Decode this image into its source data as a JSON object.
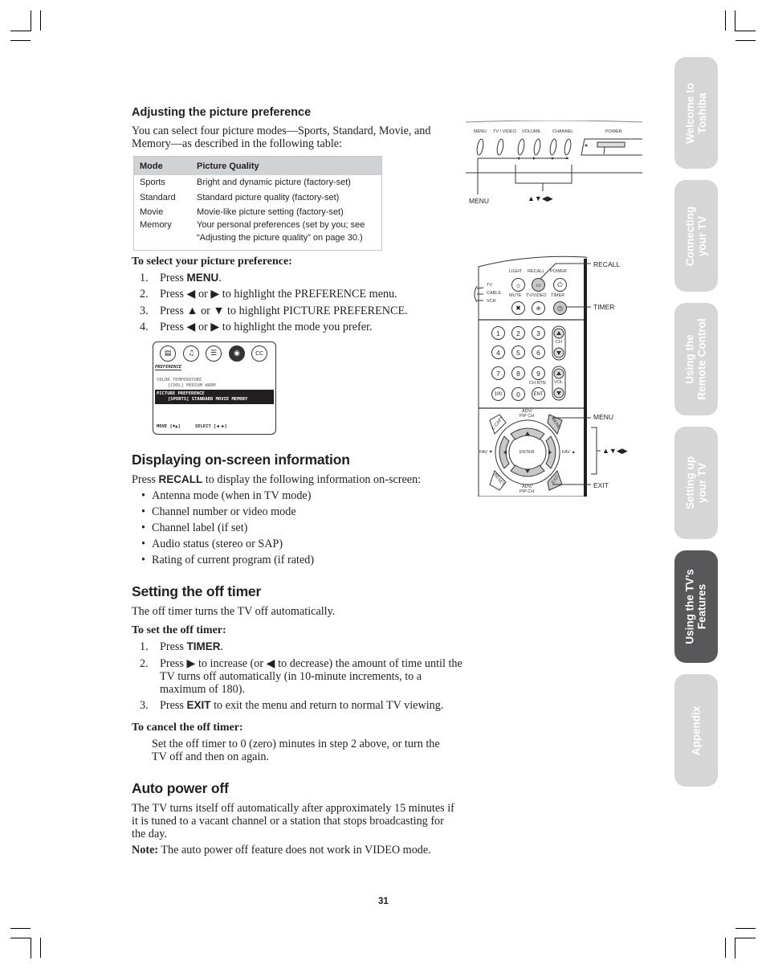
{
  "section1": {
    "heading": "Adjusting the picture preference",
    "intro_line1": "You can select four picture modes—Sports, Standard, Movie, and",
    "intro_line2": "Memory—as described in the following table:",
    "table": {
      "headers": [
        "Mode",
        "Picture Quality"
      ],
      "rows": [
        {
          "mode": "Sports",
          "quality": "Bright and dynamic picture (factory-set)"
        },
        {
          "mode": "Standard",
          "quality": "Standard picture quality (factory-set)"
        },
        {
          "mode": "Movie",
          "quality": "Movie-like picture setting  (factory-set)"
        },
        {
          "mode": "Memory",
          "quality": "Your personal preferences (set by you; see",
          "quality2": "“Adjusting the picture quality” on page 30.)"
        }
      ]
    },
    "procedure_title": "To select your picture preference:",
    "steps": [
      {
        "num": "1.",
        "pre": "Press ",
        "kw": "MENU",
        "post": "."
      },
      {
        "num": "2.",
        "pre": "Press ◀ or ▶ to highlight the PREFERENCE menu."
      },
      {
        "num": "3.",
        "pre": "Press ▲ or ▼ to highlight PICTURE PREFERENCE."
      },
      {
        "num": "4.",
        "pre": "Press ◀ or ▶ to highlight the mode you prefer."
      }
    ],
    "osd": {
      "icons": [
        "picture-icon",
        "audio-icon",
        "setup-icon",
        "preference-icon",
        "cc-icon"
      ],
      "cc_label": "CC",
      "menu_title": "PREFERENCE",
      "color_temp_label": "COLOR TEMPERATURE",
      "color_temp_options": "[COOL] MEDIUM WARM",
      "picture_pref_label": "PICTURE PREFERENCE",
      "picture_pref_options": "[SPORTS] STANDARD  MOVIE  MEMORY",
      "move_hint": "MOVE [▼▲]",
      "select_hint": "SELECT [◀ ▶]"
    }
  },
  "section2": {
    "heading": "Displaying on-screen information",
    "intro_pre": "Press ",
    "intro_kw": "RECALL",
    "intro_post": " to display the following information on-screen:",
    "bullets": [
      "Antenna mode (when in TV mode)",
      "Channel number or video mode",
      "Channel label (if set)",
      "Audio status (stereo or SAP)",
      "Rating of current program (if rated)"
    ]
  },
  "section3": {
    "heading": "Setting the off timer",
    "intro": "The off timer turns the TV off automatically.",
    "procedure_title": "To set the off timer:",
    "step1": {
      "num": "1.",
      "pre": "Press ",
      "kw": "TIMER",
      "post": "."
    },
    "step2": {
      "num": "2.",
      "line1": "Press ▶ to increase (or ◀ to decrease) the amount of time until the",
      "line2": "TV turns off automatically (in 10-minute increments, to a",
      "line3": "maximum of 180)."
    },
    "step3": {
      "num": "3.",
      "pre": "Press ",
      "kw": "EXIT",
      "post": " to exit the menu and return to normal TV viewing."
    },
    "cancel_title": "To cancel the off timer:",
    "cancel_line1": "Set the off timer to 0 (zero) minutes in step 2 above, or turn the",
    "cancel_line2": "TV off and then on again."
  },
  "section4": {
    "heading": "Auto power off",
    "line1": "The TV turns itself off automatically after approximately 15 minutes if",
    "line2": "it is tuned to a vacant channel or a station that stops broadcasting for",
    "line3": "the day.",
    "note_label": "Note:",
    "note_text": " The auto power off feature does not work in VIDEO mode."
  },
  "tv_panel": {
    "labels": [
      "MENU",
      "TV / VIDEO",
      "VOLUME",
      "CHANNEL",
      "POWER"
    ],
    "callout_menu": "MENU",
    "callout_arrows": "▲▼◀▶"
  },
  "remote": {
    "top_labels": {
      "light": "LIGHT",
      "recall": "RECALL",
      "power": "POWER",
      "mute": "MUTE",
      "tvvideo": "TV/VIDEO",
      "timer": "TIMER"
    },
    "modes": [
      "TV",
      "CABLE",
      "VCR"
    ],
    "keys": [
      "1",
      "2",
      "3",
      "4",
      "5",
      "6",
      "7",
      "8",
      "9",
      "100",
      "0",
      "ENT"
    ],
    "ch_label": "CH",
    "vol_label": "VOL",
    "chrtn_label": "CH RTN",
    "adv_top": "ADV/\nPIP CH",
    "adv_label1": "ADV/",
    "adv_label2": "PIP CH",
    "enter": "ENTER",
    "fav_left": "FAV ▼",
    "fav_right": "FAV ▲",
    "ccapt": "C.CAPT",
    "menu": "MENU",
    "reset": "RESET",
    "exit": "EXIT",
    "callouts": {
      "recall": "RECALL",
      "timer": "TIMER",
      "menu": "MENU",
      "arrows": "▲▼◀▶",
      "exit": "EXIT"
    }
  },
  "tabs": [
    {
      "label": "Welcome to\nToshiba",
      "l1": "Welcome to",
      "l2": "Toshiba",
      "active": false
    },
    {
      "label": "Connecting\nyour TV",
      "l1": "Connecting",
      "l2": "your TV",
      "active": false
    },
    {
      "label": "Using the\nRemote Control",
      "l1": "Using the",
      "l2": "Remote Control",
      "active": false
    },
    {
      "label": "Setting up\nyour TV",
      "l1": "Setting up",
      "l2": "your TV",
      "active": false
    },
    {
      "label": "Using the TV’s\nFeatures",
      "l1": "Using the TV’s",
      "l2": "Features",
      "active": true
    },
    {
      "label": "Appendix",
      "l1": "Appendix",
      "l2": "",
      "active": false
    }
  ],
  "page_number": "31"
}
